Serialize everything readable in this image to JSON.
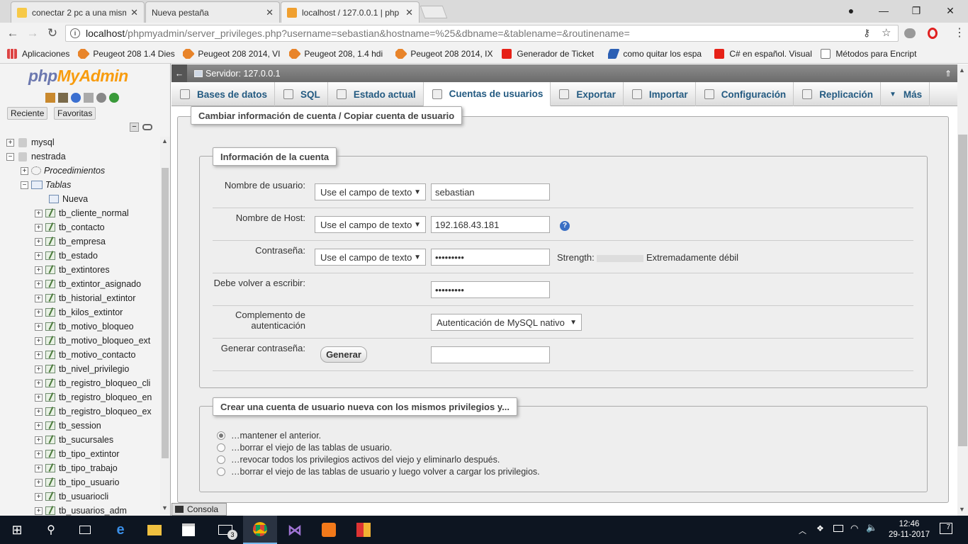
{
  "browser": {
    "tabs": [
      {
        "title": "conectar 2 pc a una misma",
        "active": false
      },
      {
        "title": "Nueva pestaña",
        "active": false
      },
      {
        "title": "localhost / 127.0.0.1 | php",
        "active": true
      }
    ],
    "url_host": "localhost",
    "url_path": "/phpmyadmin/server_privileges.php?username=sebastian&hostname=%25&dbname=&tablename=&routinename=",
    "bookmarks": [
      {
        "label": "Aplicaciones"
      },
      {
        "label": "Peugeot 208 1.4 Dies"
      },
      {
        "label": "Peugeot 208 2014, VI"
      },
      {
        "label": "Peugeot 208, 1.4 hdi"
      },
      {
        "label": "Peugeot 208 2014, IX"
      },
      {
        "label": "Generador de Ticket"
      },
      {
        "label": "como quitar los espa"
      },
      {
        "label": "C# en español. Visual"
      },
      {
        "label": "Métodos para Encript"
      }
    ]
  },
  "sidebar": {
    "logo_php": "php",
    "logo_myadmin": "MyAdmin",
    "tab_recent": "Reciente",
    "tab_favorites": "Favoritas",
    "databases": [
      "mysql",
      "nestrada"
    ],
    "procedures": "Procedimientos",
    "tables_label": "Tablas",
    "new_label": "Nueva",
    "tables": [
      "tb_cliente_normal",
      "tb_contacto",
      "tb_empresa",
      "tb_estado",
      "tb_extintores",
      "tb_extintor_asignado",
      "tb_historial_extintor",
      "tb_kilos_extintor",
      "tb_motivo_bloqueo",
      "tb_motivo_bloqueo_ext",
      "tb_motivo_contacto",
      "tb_nivel_privilegio",
      "tb_registro_bloqueo_cli",
      "tb_registro_bloqueo_en",
      "tb_registro_bloqueo_ex",
      "tb_session",
      "tb_sucursales",
      "tb_tipo_extintor",
      "tb_tipo_trabajo",
      "tb_tipo_usuario",
      "tb_usuariocli",
      "tb_usuarios_adm"
    ]
  },
  "main": {
    "server_label": "Servidor: 127.0.0.1",
    "nav": [
      {
        "label": "Bases de datos"
      },
      {
        "label": "SQL"
      },
      {
        "label": "Estado actual"
      },
      {
        "label": "Cuentas de usuarios"
      },
      {
        "label": "Exportar"
      },
      {
        "label": "Importar"
      },
      {
        "label": "Configuración"
      },
      {
        "label": "Replicación"
      },
      {
        "label": "Más"
      }
    ],
    "outer_legend": "Cambiar información de cuenta / Copiar cuenta de usuario",
    "account_legend": "Información de la cuenta",
    "fields": {
      "username_label": "Nombre de usuario:",
      "username_select": "Use el campo de texto",
      "username_value": "sebastian",
      "host_label": "Nombre de Host:",
      "host_select": "Use el campo de texto",
      "host_value": "192.168.43.181",
      "password_label": "Contraseña:",
      "password_select": "Use el campo de texto",
      "password_value": "•••••••••",
      "strength_label": "Strength:",
      "strength_value": "Extremadamente débil",
      "retype_label": "Debe volver a escribir:",
      "retype_value": "•••••••••",
      "auth_label_1": "Complemento de",
      "auth_label_2": "autenticación",
      "auth_value": "Autenticación de MySQL nativo",
      "gen_label": "Generar contraseña:",
      "gen_button": "Generar",
      "gen_value": ""
    },
    "copy_legend": "Crear una cuenta de usuario nueva con los mismos privilegios y...",
    "options": [
      {
        "label": "…mantener el anterior.",
        "checked": true
      },
      {
        "label": "…borrar el viejo de las tablas de usuario.",
        "checked": false
      },
      {
        "label": "…revocar todos los privilegios activos del viejo y eliminarlo después.",
        "checked": false
      },
      {
        "label": "…borrar el viejo de las tablas de usuario y luego volver a cargar los privilegios.",
        "checked": false
      }
    ],
    "console_label": "Consola"
  },
  "taskbar": {
    "time": "12:46",
    "date": "29-11-2017",
    "notif_count": "7",
    "mail_badge": "3"
  }
}
